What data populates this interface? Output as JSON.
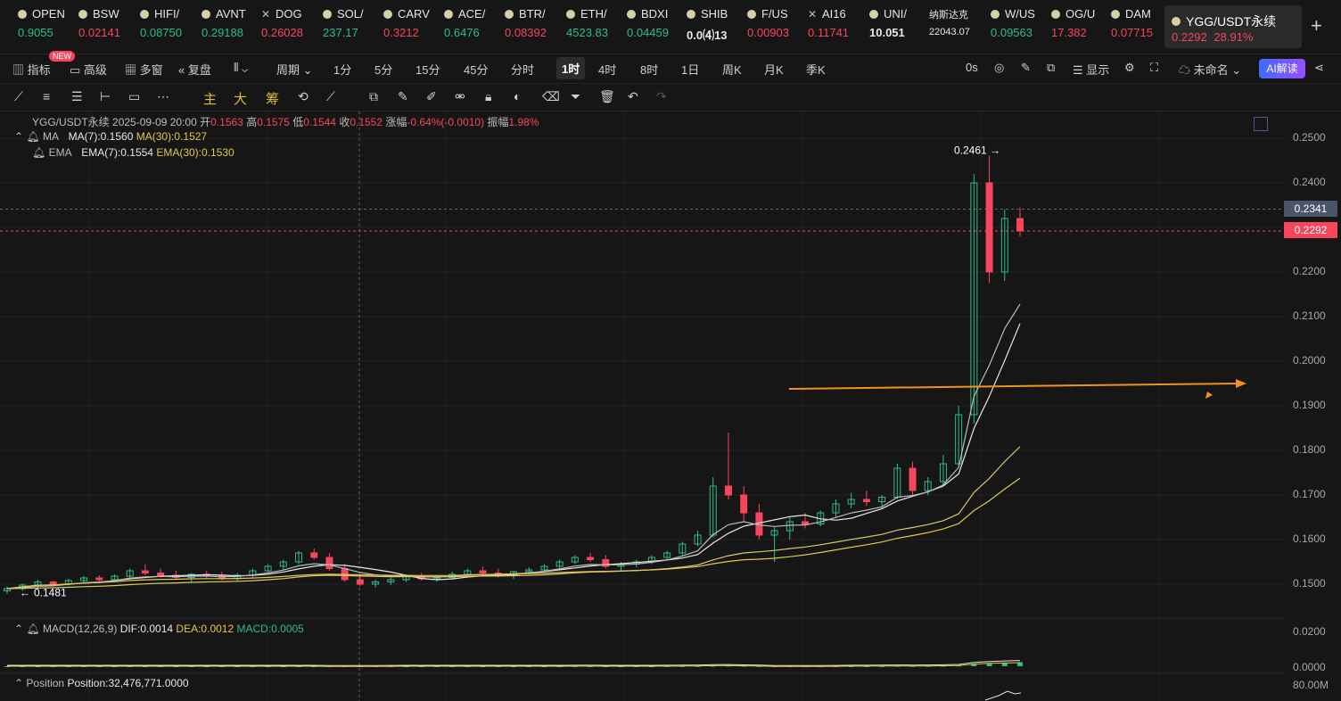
{
  "tickers": [
    {
      "symbol": "OPEN",
      "price": "0.9055",
      "trend": "up",
      "mark": "dot"
    },
    {
      "symbol": "BSW",
      "price": "0.02141",
      "trend": "down",
      "mark": "dot"
    },
    {
      "symbol": "HIFI/",
      "price": "0.08750",
      "trend": "up",
      "mark": "dot"
    },
    {
      "symbol": "AVNT",
      "price": "0.29188",
      "trend": "up",
      "mark": "dot"
    },
    {
      "symbol": "DOG",
      "price": "0.26028",
      "trend": "down",
      "mark": "x"
    },
    {
      "symbol": "SOL/",
      "price": "237.17",
      "trend": "up",
      "mark": "dot"
    },
    {
      "symbol": "CARV",
      "price": "0.3212",
      "trend": "down",
      "mark": "dot"
    },
    {
      "symbol": "ACE/",
      "price": "0.6476",
      "trend": "up",
      "mark": "dot"
    },
    {
      "symbol": "BTR/",
      "price": "0.08392",
      "trend": "down",
      "mark": "dot"
    },
    {
      "symbol": "ETH/",
      "price": "4523.83",
      "trend": "up",
      "mark": "dot"
    },
    {
      "symbol": "BDXI",
      "price": "0.04459",
      "trend": "up",
      "mark": "dot"
    },
    {
      "symbol": "SHIB",
      "price": "0.0⑷13",
      "trend": "neutral",
      "mark": "dot"
    },
    {
      "symbol": "F/US",
      "price": "0.00903",
      "trend": "down",
      "mark": "dot"
    },
    {
      "symbol": "AI16",
      "price": "0.11741",
      "trend": "down",
      "mark": "x"
    },
    {
      "symbol": "UNI/",
      "price": "10.051",
      "trend": "neutral",
      "mark": "dot"
    },
    {
      "symbol": "纳斯达克",
      "price": "22043.07",
      "trend": "neutral",
      "mark": "none"
    },
    {
      "symbol": "W/US",
      "price": "0.09563",
      "trend": "up",
      "mark": "dot"
    },
    {
      "symbol": "OG/U",
      "price": "17.382",
      "trend": "down",
      "mark": "dot"
    },
    {
      "symbol": "DAM",
      "price": "0.07715",
      "trend": "down",
      "mark": "dot"
    }
  ],
  "active_ticker": {
    "symbol": "YGG/USDT永续",
    "price": "0.2292",
    "change": "28.91%"
  },
  "toolbar": {
    "indicators": "指标",
    "new_tag": "NEW",
    "advanced": "高级",
    "multi_window": "多窗",
    "replay": "复盘",
    "period": "周期",
    "intervals": [
      "1分",
      "5分",
      "15分",
      "45分",
      "分时",
      "1时",
      "4时",
      "8时",
      "1日",
      "周K",
      "月K",
      "季K"
    ],
    "active_interval": "1时",
    "timer": "0s",
    "display": "显示",
    "account": "未命名",
    "ai": "AI解读"
  },
  "drawtools": {
    "main": "主",
    "big": "大",
    "chip": "筹"
  },
  "chart_header": {
    "pair": "YGG/USDT永续",
    "time": "2025-09-09 20:00",
    "open_label": "开",
    "open": "0.1563",
    "high_label": "高",
    "high": "0.1575",
    "low_label": "低",
    "low": "0.1544",
    "close_label": "收",
    "close": "0.1552",
    "chg_label": "涨幅",
    "chg": "-0.64%(-0.0010)",
    "amp_label": "振幅",
    "amp": "1.98%"
  },
  "ma_legend": {
    "name": "MA",
    "ma7": "MA(7):0.1560",
    "ma30": "MA(30):0.1527"
  },
  "ema_legend": {
    "name": "EMA",
    "ema7": "EMA(7):0.1554",
    "ema30": "EMA(30):0.1530"
  },
  "macd_legend": {
    "name": "MACD(12,26,9)",
    "dif": "DIF:0.0014",
    "dea": "DEA:0.0012",
    "macd": "MACD:0.0005"
  },
  "position_legend": {
    "name": "Position",
    "value": "Position:32,476,771.0000"
  },
  "price_axis": [
    "0.2500",
    "0.2400",
    "0.2300",
    "0.2200",
    "0.2100",
    "0.2000",
    "0.1900",
    "0.1800",
    "0.1700",
    "0.1600",
    "0.1500"
  ],
  "macd_axis": [
    "0.0200",
    "0.0000"
  ],
  "pos_axis": "80.00M",
  "crosshair_price": "0.2341",
  "last_price": "0.2292",
  "high_marker": "0.2461",
  "low_marker": "0.1481",
  "colors": {
    "up": "#2ebd85",
    "down": "#f6465d",
    "ma_white": "#e8e8e8",
    "ma_yellow": "#e3c74b",
    "arrow": "#f0931e"
  },
  "chart_data": {
    "type": "candlestick",
    "interval": "1时",
    "ylim": [
      0.145,
      0.255
    ],
    "marked_high": 0.2461,
    "marked_low": 0.1481,
    "last": 0.2292,
    "candles": [
      [
        0.1485,
        0.1495,
        0.1478,
        0.149
      ],
      [
        0.149,
        0.1502,
        0.1485,
        0.1498
      ],
      [
        0.1498,
        0.151,
        0.1492,
        0.1505
      ],
      [
        0.1505,
        0.1508,
        0.1495,
        0.15
      ],
      [
        0.15,
        0.1512,
        0.1497,
        0.1508
      ],
      [
        0.1508,
        0.1518,
        0.1503,
        0.1514
      ],
      [
        0.1514,
        0.152,
        0.1506,
        0.151
      ],
      [
        0.151,
        0.1522,
        0.1507,
        0.1518
      ],
      [
        0.1518,
        0.1535,
        0.1515,
        0.153
      ],
      [
        0.153,
        0.1545,
        0.152,
        0.1525
      ],
      [
        0.1525,
        0.1535,
        0.1515,
        0.152
      ],
      [
        0.152,
        0.153,
        0.151,
        0.1515
      ],
      [
        0.1515,
        0.1525,
        0.1505,
        0.1522
      ],
      [
        0.1522,
        0.153,
        0.1512,
        0.1518
      ],
      [
        0.1518,
        0.1528,
        0.1508,
        0.1512
      ],
      [
        0.1512,
        0.1525,
        0.1505,
        0.152
      ],
      [
        0.152,
        0.1535,
        0.1515,
        0.153
      ],
      [
        0.153,
        0.1545,
        0.1525,
        0.154
      ],
      [
        0.154,
        0.1555,
        0.1532,
        0.155
      ],
      [
        0.155,
        0.1575,
        0.1545,
        0.157
      ],
      [
        0.157,
        0.158,
        0.1555,
        0.156
      ],
      [
        0.156,
        0.157,
        0.153,
        0.1535
      ],
      [
        0.1535,
        0.1545,
        0.1505,
        0.151
      ],
      [
        0.151,
        0.152,
        0.1495,
        0.15
      ],
      [
        0.15,
        0.151,
        0.1492,
        0.1505
      ],
      [
        0.1505,
        0.1515,
        0.1498,
        0.151
      ],
      [
        0.151,
        0.1522,
        0.1505,
        0.1518
      ],
      [
        0.1518,
        0.1525,
        0.1508,
        0.1512
      ],
      [
        0.1512,
        0.152,
        0.1505,
        0.1515
      ],
      [
        0.1515,
        0.1528,
        0.151,
        0.1522
      ],
      [
        0.1522,
        0.1535,
        0.1518,
        0.153
      ],
      [
        0.153,
        0.154,
        0.152,
        0.1525
      ],
      [
        0.1525,
        0.1535,
        0.1515,
        0.152
      ],
      [
        0.152,
        0.153,
        0.1512,
        0.1528
      ],
      [
        0.1528,
        0.1538,
        0.1522,
        0.1532
      ],
      [
        0.1532,
        0.1545,
        0.1528,
        0.154
      ],
      [
        0.154,
        0.1555,
        0.1535,
        0.155
      ],
      [
        0.155,
        0.1565,
        0.1545,
        0.156
      ],
      [
        0.156,
        0.157,
        0.155,
        0.1555
      ],
      [
        0.1555,
        0.1565,
        0.1535,
        0.154
      ],
      [
        0.154,
        0.155,
        0.153,
        0.1545
      ],
      [
        0.1545,
        0.1555,
        0.1538,
        0.155
      ],
      [
        0.155,
        0.1565,
        0.1545,
        0.156
      ],
      [
        0.156,
        0.1575,
        0.1555,
        0.157
      ],
      [
        0.157,
        0.1595,
        0.1565,
        0.159
      ],
      [
        0.159,
        0.162,
        0.1585,
        0.161
      ],
      [
        0.161,
        0.174,
        0.1605,
        0.172
      ],
      [
        0.172,
        0.184,
        0.169,
        0.17
      ],
      [
        0.17,
        0.172,
        0.164,
        0.166
      ],
      [
        0.166,
        0.168,
        0.16,
        0.161
      ],
      [
        0.161,
        0.163,
        0.155,
        0.162
      ],
      [
        0.162,
        0.165,
        0.16,
        0.164
      ],
      [
        0.164,
        0.166,
        0.1625,
        0.1635
      ],
      [
        0.1635,
        0.1665,
        0.163,
        0.166
      ],
      [
        0.166,
        0.169,
        0.165,
        0.168
      ],
      [
        0.168,
        0.1705,
        0.167,
        0.169
      ],
      [
        0.169,
        0.171,
        0.1675,
        0.1685
      ],
      [
        0.1685,
        0.17,
        0.167,
        0.1695
      ],
      [
        0.1695,
        0.177,
        0.169,
        0.176
      ],
      [
        0.176,
        0.1775,
        0.17,
        0.171
      ],
      [
        0.171,
        0.174,
        0.17,
        0.173
      ],
      [
        0.173,
        0.179,
        0.172,
        0.177
      ],
      [
        0.177,
        0.19,
        0.1765,
        0.188
      ],
      [
        0.188,
        0.242,
        0.186,
        0.24
      ],
      [
        0.24,
        0.2461,
        0.2175,
        0.22
      ],
      [
        0.22,
        0.234,
        0.218,
        0.232
      ],
      [
        0.232,
        0.2345,
        0.228,
        0.2292
      ]
    ],
    "macd_hist": [
      0,
      0,
      0,
      0,
      0,
      0,
      0,
      0,
      0,
      0,
      0,
      0,
      0,
      0,
      0,
      0,
      0,
      0,
      0,
      0,
      0,
      -0.0002,
      -0.0003,
      -0.0003,
      -0.0002,
      -0.0001,
      0,
      0,
      0,
      0,
      0,
      0,
      0,
      0,
      0,
      0,
      0,
      0.0001,
      0.0001,
      0,
      0,
      0,
      0,
      0.0001,
      0.0002,
      0.0003,
      0.0007,
      0.0008,
      0.0005,
      0.0002,
      -0.0002,
      -0.0003,
      -0.0003,
      -0.0002,
      -0.0001,
      0.0001,
      0.0001,
      0.0002,
      0.0004,
      0.0003,
      0.0004,
      0.0006,
      0.0009,
      0.003,
      0.004,
      0.0045,
      0.005
    ]
  }
}
